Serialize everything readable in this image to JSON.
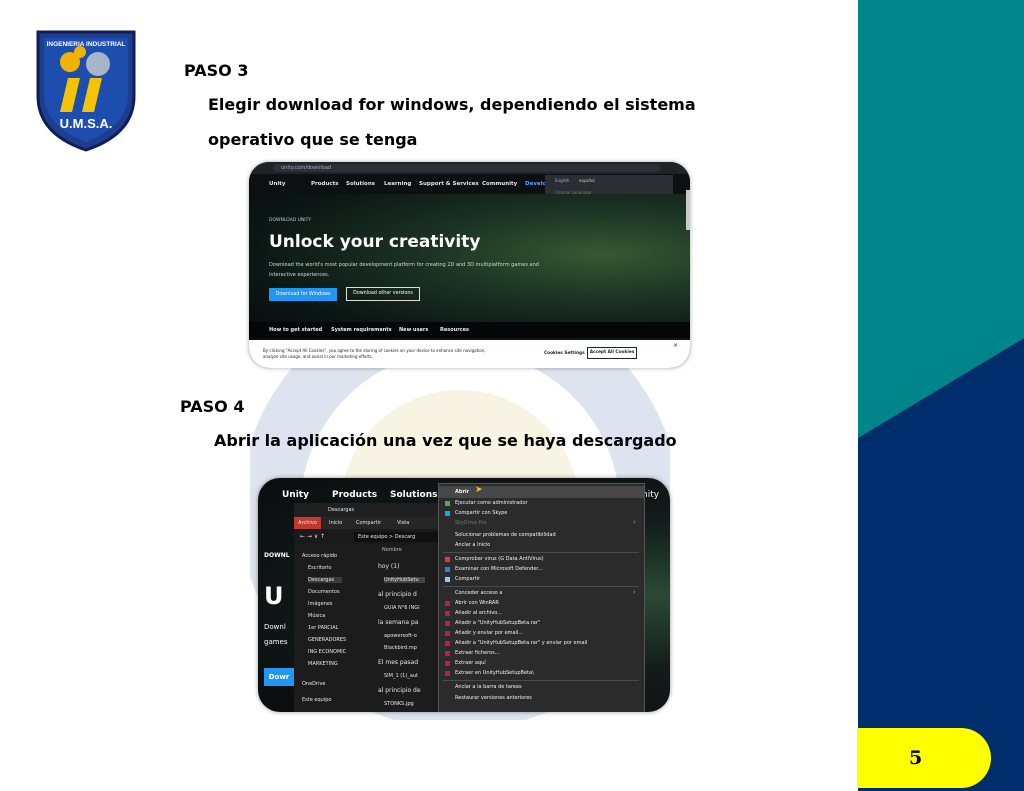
{
  "logo": {
    "arc_text": "INGENIERIA INDUSTRIAL",
    "bottom_text": "U.M.S.A."
  },
  "colors": {
    "teal": "#00868a",
    "navy": "#002d6b",
    "yellow": "#ffff00",
    "accent_blue": "#2196f3"
  },
  "step3": {
    "title": "PASO 3",
    "line1": "Elegir download for windows, dependiendo el sistema",
    "line2": "operativo que se tenga"
  },
  "step4": {
    "title": "PASO 4",
    "line1": "Abrir la aplicación una vez que se haya descargado"
  },
  "unity_page": {
    "url": "unity.com/download",
    "nav": [
      "Unity",
      "Products",
      "Solutions",
      "Learning",
      "Support & Services",
      "Community",
      "Develo"
    ],
    "lang_options": [
      "English",
      "español"
    ],
    "lang_hint": "Change Language",
    "sub": "DOWNLOAD UNITY",
    "headline": "Unlock your creativity",
    "desc": "Download the world's most popular development platform for creating 2D and 3D multiplatform games and interactive experiences.",
    "btn_windows": "Download for Windows",
    "btn_other": "Download other versions",
    "tabs": [
      "How to get started",
      "System requirements",
      "New users",
      "Resources"
    ],
    "cookie_text": "By clicking \"Accept All Cookies\", you agree to the storing of cookies on your device to enhance site navigation, analyze site usage, and assist in our marketing efforts.",
    "cookie_settings": "Cookies Settings",
    "cookie_accept": "Accept All Cookies",
    "cookie_close": "×"
  },
  "explorer_shot": {
    "nav": [
      "Unity",
      "Products",
      "Solutions"
    ],
    "right_text": "nity",
    "left_fragments": [
      "DOWNL",
      "U",
      "Downl",
      "games",
      "Dowr"
    ],
    "title": "Descargas",
    "ribbon": [
      "Archivo",
      "Inicio",
      "Compartir",
      "Vista"
    ],
    "address": "Este equipo > Descarg",
    "nav_items": [
      "Acceso rápido",
      "Escritorio",
      "Descargas",
      "Documentos",
      "Imágenes",
      "Música",
      "1er PARCIAL",
      "GENERADORES",
      "ING ECONOMIC",
      "MARKETING",
      "OneDrive",
      "Este equipo"
    ],
    "col_header": "Nombre",
    "file_items": [
      "hoy (1)",
      "UnityHubSetu",
      "al principio d",
      "GUIA N°6 INGI",
      "la semana pa",
      "apowersoft-o",
      "Blackbird.mp",
      "El mes pasad",
      "SIM_1 (1)_aut",
      "al principio de",
      "STONKS.jpg"
    ],
    "context_menu": [
      "Abrir",
      "Ejecutar como administrador",
      "Compartir con Skype",
      "SkyDrive Pro",
      "Solucionar problemas de compatibilidad",
      "Anclar a Inicio",
      "Comprobar virus (G Data AntiVirus)",
      "Examinar con Microsoft Defender...",
      "Compartir",
      "Conceder acceso a",
      "Abrir con WinRAR",
      "Añadir al archivo...",
      "Añadir a \"UnityHubSetupBeta.rar\"",
      "Añadir y enviar por email...",
      "Añadir a \"UnityHubSetupBeta.rar\" y enviar por email",
      "Extraer ficheros...",
      "Extraer aquí",
      "Extraer en UnityHubSetupBeta\\",
      "Anclar a la barra de tareas",
      "Restaurar versiones anteriores"
    ]
  },
  "page_number": "5"
}
